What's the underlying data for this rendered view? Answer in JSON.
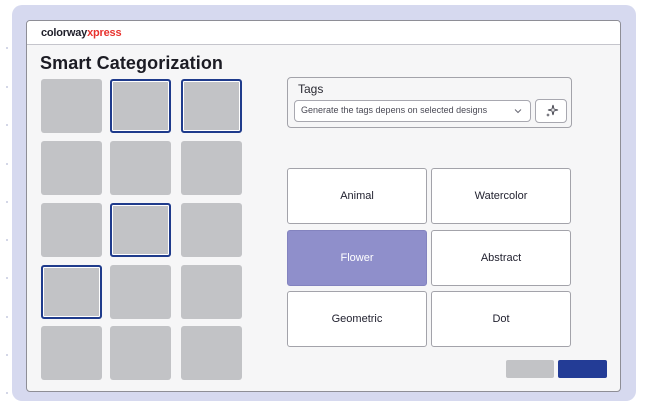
{
  "app": {
    "logo_part1": "colorway",
    "logo_x": "x",
    "logo_part2": "press",
    "page_title": "Smart Categorization"
  },
  "design_grid": {
    "rows": 5,
    "columns": 3,
    "selected": [
      [
        0,
        1
      ],
      [
        0,
        2
      ],
      [
        2,
        1
      ],
      [
        3,
        0
      ]
    ]
  },
  "tags": {
    "label": "Tags",
    "select_value": "Generate the tags depens on selected designs",
    "chevron_icon": "chevron-down-icon",
    "magic_icon": "sparkle-icon"
  },
  "categories": [
    {
      "label": "Animal",
      "active": false
    },
    {
      "label": "Watercolor",
      "active": false
    },
    {
      "label": "Flower",
      "active": true
    },
    {
      "label": "Abstract",
      "active": false
    },
    {
      "label": "Geometric",
      "active": false
    },
    {
      "label": "Dot",
      "active": false
    }
  ],
  "colors": {
    "frame": "#d6d9ef",
    "selection_border": "#1f3b8c",
    "active_category": "#8f8fcb",
    "primary_button": "#233c96",
    "secondary_button": "#c2c3c6",
    "logo_accent": "#e8322e"
  }
}
